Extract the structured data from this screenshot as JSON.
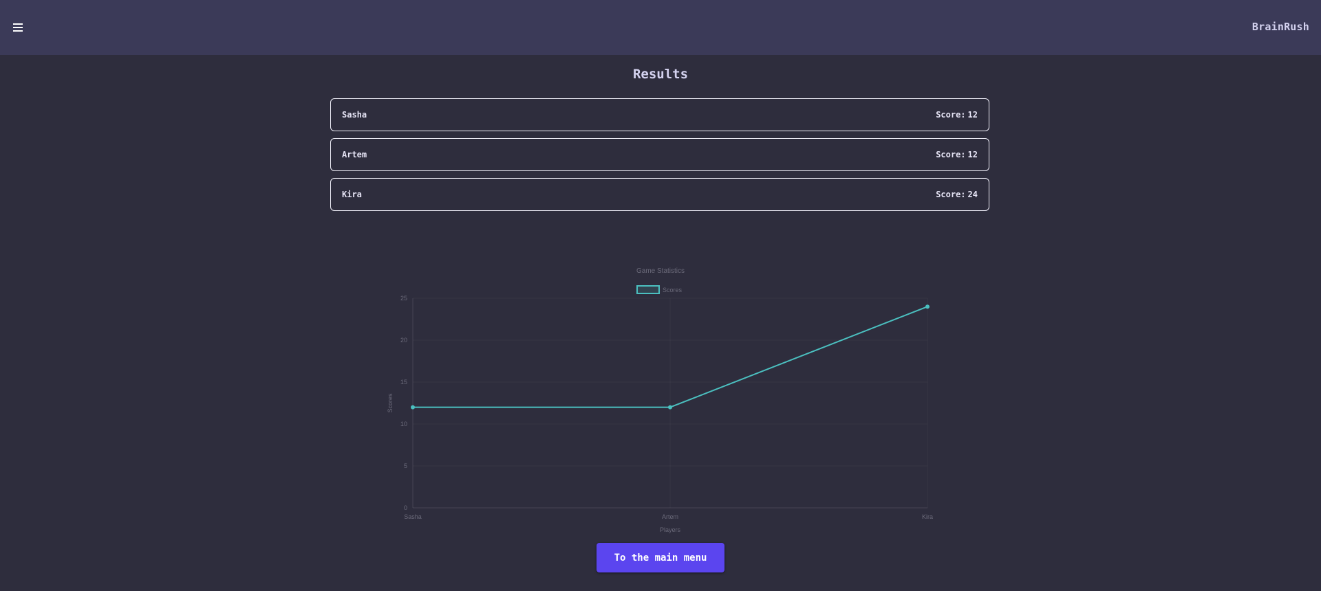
{
  "header": {
    "menu_icon": "hamburger-menu-icon",
    "brand": "BrainRush"
  },
  "results": {
    "title": "Results",
    "score_label": "Score:",
    "players": [
      {
        "name": "Sasha",
        "score": "12"
      },
      {
        "name": "Artem",
        "score": "12"
      },
      {
        "name": "Kira",
        "score": "24"
      }
    ]
  },
  "chart_data": {
    "type": "line",
    "title": "Game Statistics",
    "xlabel": "Players",
    "ylabel": "Scores",
    "categories": [
      "Sasha",
      "Artem",
      "Kira"
    ],
    "series": [
      {
        "name": "Scores",
        "values": [
          12,
          12,
          24
        ],
        "color": "#4bc0c0"
      }
    ],
    "ylim": [
      0,
      25
    ],
    "yticks": [
      0,
      5,
      10,
      15,
      20,
      25
    ],
    "grid": true,
    "legend": "top"
  },
  "actions": {
    "main_menu_label": "To the main menu"
  },
  "colors": {
    "background": "#2e2d3d",
    "header": "#3b3a58",
    "accent": "#5b45ef",
    "line": "#4bc0c0"
  }
}
